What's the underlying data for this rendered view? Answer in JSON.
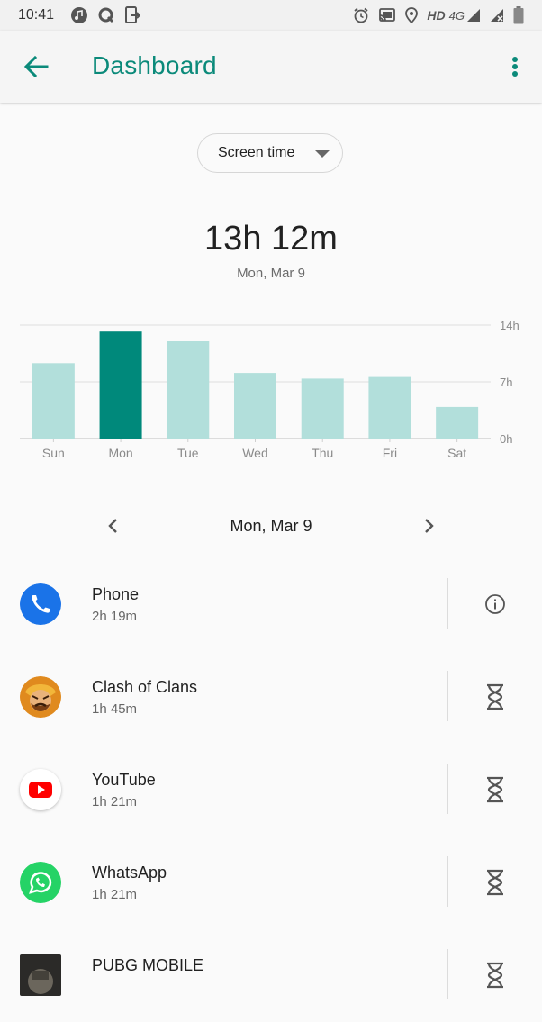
{
  "status_bar": {
    "time": "10:41",
    "network_label": "HD",
    "network_type": "4G",
    "left_icons": [
      "music-icon",
      "q-app-icon",
      "sim-exit-icon"
    ],
    "right_icons": [
      "alarm-icon",
      "cast-icon",
      "location-icon",
      "signal-icon",
      "signal-x-icon",
      "battery-icon"
    ]
  },
  "app_bar": {
    "title": "Dashboard",
    "accent_color": "#0b8a7a"
  },
  "metric_selector": {
    "selected": "Screen time"
  },
  "summary": {
    "total": "13h 12m",
    "date": "Mon, Mar 9"
  },
  "chart_data": {
    "type": "bar",
    "categories": [
      "Sun",
      "Mon",
      "Tue",
      "Wed",
      "Thu",
      "Fri",
      "Sat"
    ],
    "values": [
      9.3,
      13.2,
      12.0,
      8.1,
      7.4,
      7.6,
      3.9
    ],
    "unit": "hours",
    "y_ticks": [
      "0h",
      "7h",
      "14h"
    ],
    "y_tick_values": [
      0,
      7,
      14
    ],
    "ylim": [
      0,
      14
    ],
    "selected_index": 1,
    "bar_color": "#b2dfdb",
    "selected_bar_color": "#00897b",
    "grid": true
  },
  "day_nav": {
    "date": "Mon, Mar 9"
  },
  "apps": [
    {
      "name": "Phone",
      "usage": "2h 19m",
      "icon": "phone-app-icon",
      "action_icon": "info-icon"
    },
    {
      "name": "Clash of Clans",
      "usage": "1h 45m",
      "icon": "clash-of-clans-app-icon",
      "action_icon": "hourglass-icon"
    },
    {
      "name": "YouTube",
      "usage": "1h 21m",
      "icon": "youtube-app-icon",
      "action_icon": "hourglass-icon"
    },
    {
      "name": "WhatsApp",
      "usage": "1h 21m",
      "icon": "whatsapp-app-icon",
      "action_icon": "hourglass-icon"
    },
    {
      "name": "PUBG MOBILE",
      "usage": "",
      "icon": "pubg-app-icon",
      "action_icon": "hourglass-icon"
    }
  ]
}
